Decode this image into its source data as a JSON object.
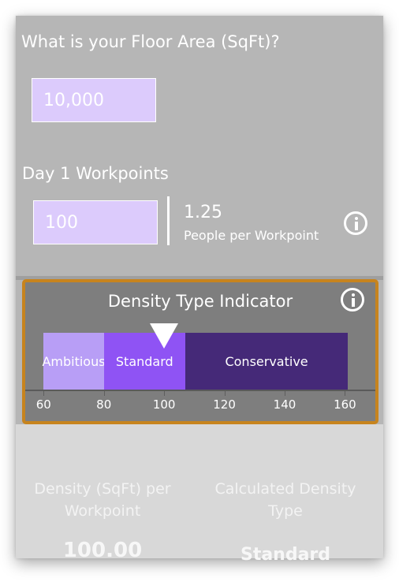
{
  "floor_area": {
    "question": "What is your Floor Area (SqFt)?",
    "value": "10,000"
  },
  "workpoints": {
    "label": "Day 1 Workpoints",
    "value": "100",
    "ratio_value": "1.25",
    "ratio_label": "People per Workpoint"
  },
  "density_indicator": {
    "title": "Density Type Indicator",
    "bands": [
      {
        "label": "Ambitious",
        "color": "#b89ef6",
        "from": 60,
        "to": 80
      },
      {
        "label": "Standard",
        "color": "#8f53f4",
        "from": 80,
        "to": 107
      },
      {
        "label": "Conservative",
        "color": "#452978",
        "from": 107,
        "to": 161
      }
    ],
    "axis_ticks": [
      "60",
      "80",
      "100",
      "120",
      "140",
      "160"
    ],
    "axis_min": 56,
    "axis_max": 168,
    "marker_value": 100
  },
  "results": {
    "density_label": "Density (SqFt) per Workpoint",
    "density_value": "100.00",
    "type_label": "Calculated Density Type",
    "type_value": "Standard"
  },
  "icons": {
    "info": "info-circle-icon",
    "marker": "triangle-down-marker-icon"
  },
  "colors": {
    "panel_gray": "#b6b6b6",
    "indicator_border": "#c7841e",
    "input_fill": "#dccbfc"
  }
}
